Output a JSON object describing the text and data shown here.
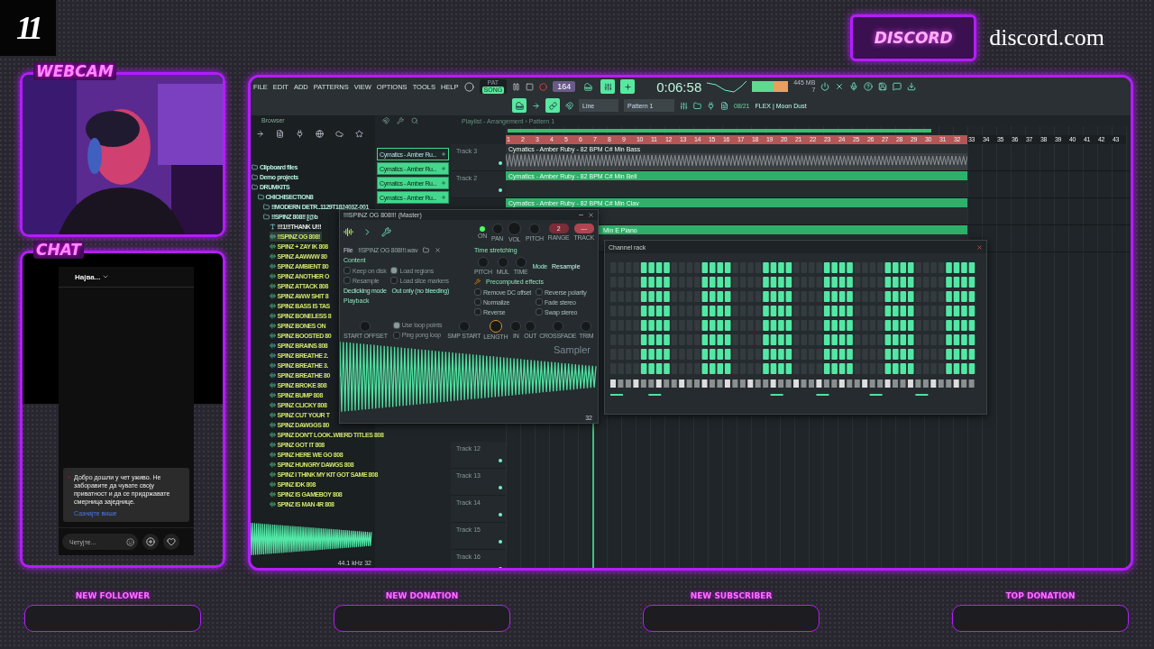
{
  "logo": "11",
  "discord": {
    "badge": "DISCORD",
    "url": "discord.com"
  },
  "webcam": {
    "label": "WEBCAM"
  },
  "chat": {
    "label": "CHAT",
    "sort": "Најва...",
    "notice": {
      "text": "Добро дошли у чет уживо. Не заборавите да чувате своју приватност и да се придржавате смерница заједнице.",
      "link": "Сазнајте више"
    },
    "input": {
      "placeholder": "Четујте..."
    }
  },
  "daw": {
    "menu": [
      "FILE",
      "EDIT",
      "ADD",
      "PATTERNS",
      "VIEW",
      "OPTIONS",
      "TOOLS",
      "HELP"
    ],
    "modes": [
      {
        "label": "PAT",
        "selected": false
      },
      {
        "label": "SONG",
        "selected": true
      }
    ],
    "tempo": "164",
    "time": "0:06:58",
    "memory": "445 MB",
    "cpu": "7",
    "snap": "Line",
    "pattern": "Pattern 1",
    "news": {
      "date": "08/21",
      "title": "FLEX | Moon Dust"
    },
    "browser": {
      "title": "Browser",
      "sample_info": "44.1 kHz 32",
      "tree": [
        {
          "kind": "folder",
          "label": "Clipboard files",
          "selected": false
        },
        {
          "kind": "folder",
          "label": "Demo projects",
          "selected": false
        },
        {
          "kind": "folder",
          "label": "DRUMKITS",
          "selected": false,
          "children": [
            {
              "kind": "folder",
              "label": "CHICHISECTION8",
              "selected": false,
              "children": [
                {
                  "kind": "folder",
                  "label": "!!MODERN DETR..1129T182403Z-001",
                  "selected": false
                },
                {
                  "kind": "folder",
                  "label": "!!SPINZ 808!! [@b",
                  "selected": false,
                  "children": [
                    {
                      "kind": "text",
                      "label": "!!!1!!!THANK U!!!",
                      "selected": false
                    },
                    {
                      "kind": "audio",
                      "label": "!!SPINZ OG 808!",
                      "selected": true
                    },
                    {
                      "kind": "audio",
                      "label": "SPINZ + ZAY IK 808",
                      "selected": false
                    },
                    {
                      "kind": "audio",
                      "label": "SPINZ AAWWW 80",
                      "selected": false
                    },
                    {
                      "kind": "audio",
                      "label": "SPINZ AMBIENT 80",
                      "selected": false
                    },
                    {
                      "kind": "audio",
                      "label": "SPINZ ANOTHER O",
                      "selected": false
                    },
                    {
                      "kind": "audio",
                      "label": "SPINZ ATTACK 808",
                      "selected": false
                    },
                    {
                      "kind": "audio",
                      "label": "SPINZ AWW SHIT 8",
                      "selected": false
                    },
                    {
                      "kind": "audio",
                      "label": "SPINZ BASS IS TAS",
                      "selected": false
                    },
                    {
                      "kind": "audio",
                      "label": "SPINZ BONELESS 8",
                      "selected": false
                    },
                    {
                      "kind": "audio",
                      "label": "SPINZ BONES ON",
                      "selected": false
                    },
                    {
                      "kind": "audio",
                      "label": "SPINZ BOOSTED 80",
                      "selected": false
                    },
                    {
                      "kind": "audio",
                      "label": "SPINZ BRAINS 808",
                      "selected": false
                    },
                    {
                      "kind": "audio",
                      "label": "SPINZ BREATHE 2.",
                      "selected": false
                    },
                    {
                      "kind": "audio",
                      "label": "SPINZ BREATHE 3.",
                      "selected": false
                    },
                    {
                      "kind": "audio",
                      "label": "SPINZ BREATHE 80",
                      "selected": false
                    },
                    {
                      "kind": "audio",
                      "label": "SPINZ BROKE 808",
                      "selected": false
                    },
                    {
                      "kind": "audio",
                      "label": "SPINZ BUMP 808",
                      "selected": false
                    },
                    {
                      "kind": "audio",
                      "label": "SPINZ CLICKY 808",
                      "selected": false
                    },
                    {
                      "kind": "audio",
                      "label": "SPINZ CUT YOUR T",
                      "selected": false
                    },
                    {
                      "kind": "audio",
                      "label": "SPINZ DAWGGS 80",
                      "selected": false
                    },
                    {
                      "kind": "audio",
                      "label": "SPINZ DON'T LOOK..WIERD TITLES 808",
                      "selected": false
                    },
                    {
                      "kind": "audio",
                      "label": "SPINZ GOT IT 808",
                      "selected": false
                    },
                    {
                      "kind": "audio",
                      "label": "SPINZ HERE WE GO 808",
                      "selected": false
                    },
                    {
                      "kind": "audio",
                      "label": "SPINZ HUNGRY DAWGS 808",
                      "selected": false
                    },
                    {
                      "kind": "audio",
                      "label": "SPINZ I THINK MY KIT GOT SAME 808",
                      "selected": false
                    },
                    {
                      "kind": "audio",
                      "label": "SPINZ IDK 808",
                      "selected": false
                    },
                    {
                      "kind": "audio",
                      "label": "SPINZ IS GAMEBOY 808",
                      "selected": false
                    },
                    {
                      "kind": "audio",
                      "label": "SPINZ IS MAN 4R 808",
                      "selected": false
                    }
                  ]
                }
              ]
            }
          ]
        }
      ]
    },
    "patterns": [
      {
        "label": "Cymatics - Amber Ru...",
        "selected": true
      },
      {
        "label": "Cymatics - Amber Ru...",
        "selected": false
      },
      {
        "label": "Cymatics - Amber Ru...",
        "selected": false
      },
      {
        "label": "Cymatics - Amber Ru...",
        "selected": false
      }
    ],
    "playlist": {
      "title": "Playlist - Arrangement › Pattern 1",
      "bars": [
        "1",
        "2",
        "3",
        "4",
        "5",
        "6",
        "7",
        "8",
        "9",
        "10",
        "11",
        "12",
        "13",
        "14",
        "15",
        "16",
        "17",
        "18",
        "19",
        "20",
        "21",
        "22",
        "23",
        "24",
        "25",
        "26",
        "27",
        "28",
        "29",
        "30",
        "31",
        "32",
        "33",
        "34",
        "35",
        "36",
        "37",
        "38",
        "39",
        "40",
        "41",
        "42",
        "43"
      ],
      "tracks": [
        {
          "name": "Track 3",
          "clip": {
            "kind": "audio",
            "label": "Cymatics - Amber Ruby - 82 BPM C# Min Bass"
          }
        },
        {
          "name": "Track 2",
          "clip": {
            "kind": "pattern",
            "label": "Cymatics - Amber Ruby - 82 BPM C# Min Bell"
          }
        },
        {
          "clip": {
            "kind": "pattern",
            "label": "Cymatics - Amber Ruby - 82 BPM C# Min Clav"
          }
        },
        {
          "clip": {
            "kind": "covered",
            "label": "Min E Piano"
          }
        }
      ],
      "lower_tracks": [
        "Track 12",
        "Track 13",
        "Track 14",
        "Track 15",
        "Track 16"
      ]
    },
    "sampler": {
      "title": "!!!SPINZ OG 808!!! (Master)",
      "top_controls": [
        {
          "kind": "led",
          "label": "ON",
          "on": true
        },
        {
          "kind": "knob",
          "label": "PAN"
        },
        {
          "kind": "knob",
          "label": "VOL"
        },
        {
          "kind": "knob",
          "label": "PITCH"
        },
        {
          "kind": "box",
          "label": "RANGE",
          "value": "2"
        },
        {
          "kind": "track",
          "label": "TRACK",
          "value": "---"
        }
      ],
      "file": {
        "label": "File",
        "name": "!!SPINZ OG 808!!!.wav"
      },
      "content": {
        "title": "Content",
        "options": [
          {
            "label": "Keep on disk",
            "checked": false
          },
          {
            "label": "Load regions",
            "checked": true
          },
          {
            "label": "Resample",
            "checked": false
          },
          {
            "label": "Load slice markers",
            "checked": false
          }
        ]
      },
      "declicking": {
        "label": "Declicking mode",
        "value": "Out only (no bleeding)"
      },
      "playback": {
        "title": "Playback",
        "knob": "START OFFSET",
        "options": [
          {
            "label": "Use loop points",
            "checked": true
          },
          {
            "label": "Ping pong loop",
            "checked": false
          }
        ]
      },
      "time_stretching": {
        "title": "Time stretching",
        "knobs": [
          "PITCH",
          "MUL",
          "TIME"
        ],
        "mode_label": "Mode",
        "mode": "Resample"
      },
      "effects": {
        "title": "Precomputed effects",
        "options": [
          {
            "label": "Remove DC offset",
            "checked": false
          },
          {
            "label": "Reverse polarity",
            "checked": false
          },
          {
            "label": "Normalize",
            "checked": false
          },
          {
            "label": "Fade stereo",
            "checked": false
          },
          {
            "label": "Reverse",
            "checked": false
          },
          {
            "label": "Swap stereo",
            "checked": false
          }
        ]
      },
      "bottom_knobs": [
        {
          "label": "SMP START",
          "active": false
        },
        {
          "label": "LENGTH",
          "active": true
        },
        {
          "label": "IN",
          "active": false
        },
        {
          "label": "OUT",
          "active": false
        },
        {
          "label": "CROSSFADE",
          "active": false
        },
        {
          "label": "TRIM",
          "active": false
        }
      ],
      "watermark": "Sampler",
      "zoom": "32"
    },
    "channel_rack": {
      "title": "Channel rack"
    }
  },
  "alerts": [
    "NEW FOLLOWER",
    "NEW DONATION",
    "NEW SUBSCRIBER",
    "TOP DONATION"
  ]
}
